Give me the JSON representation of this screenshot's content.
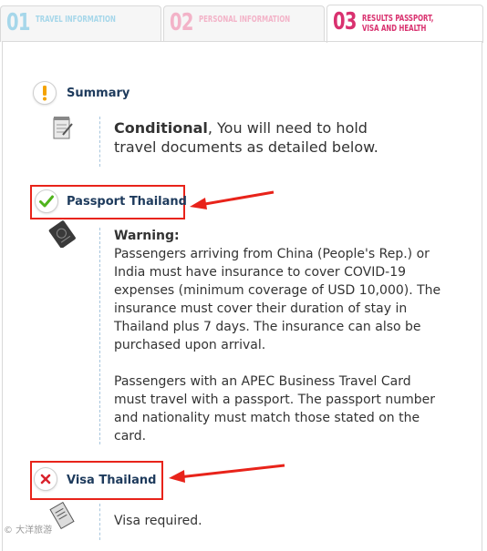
{
  "tabs": [
    {
      "number": "01",
      "label": "Travel information"
    },
    {
      "number": "02",
      "label": "Personal information"
    },
    {
      "number": "03",
      "label": "Results passport, visa and health"
    }
  ],
  "summary": {
    "title": "Summary",
    "status": "Conditional",
    "text": ", You will need to hold travel documents as detailed below."
  },
  "passport": {
    "title": "Passport Thailand",
    "warning_heading": "Warning:",
    "paragraph1": "Passengers arriving from China (People's Rep.) or India must have insurance to cover COVID-19 expenses (minimum coverage of USD 10,000). The insurance must cover their duration of stay in Thailand plus 7 days. The insurance can also be purchased upon arrival.",
    "paragraph2": "Passengers with an APEC Business Travel Card must travel with a passport. The passport number and nationality must match those stated on the card."
  },
  "visa": {
    "title": "Visa Thailand",
    "text": "Visa required."
  },
  "icons": {
    "summary": "exclamation-icon",
    "document": "notepad-icon",
    "passport_status": "checkmark-icon",
    "passport_doc": "passport-icon",
    "visa_status": "cross-icon",
    "visa_doc": "visa-icon"
  },
  "colors": {
    "active_tab": "#d9316f",
    "tab1": "#a6d7ea",
    "tab2": "#f3b3c8",
    "title": "#1d3a5c",
    "ok": "#4fb31c",
    "error": "#d9232d",
    "warning": "#f4a300",
    "highlight": "#e8231a"
  },
  "watermark": "© 大洋旅游"
}
